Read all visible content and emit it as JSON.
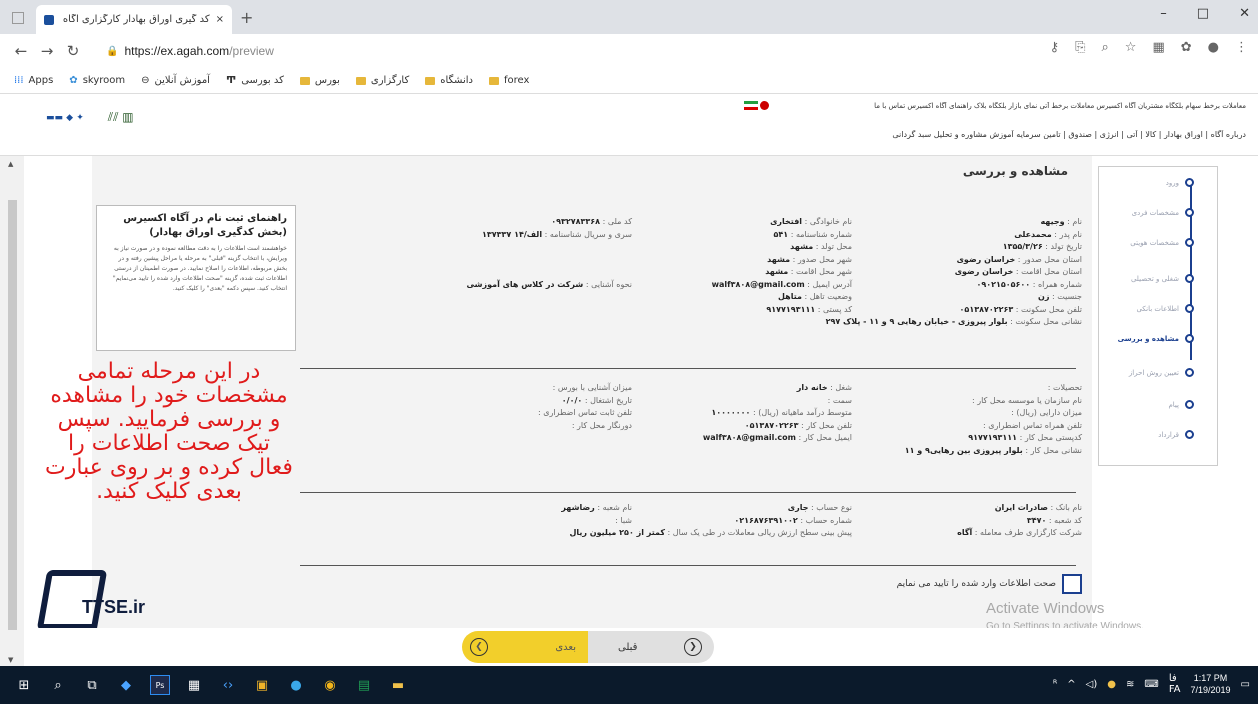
{
  "browser": {
    "tab_title": "کد گیری اوراق بهادار کارگزاری آگاه",
    "tab_close": "×",
    "new_tab": "+",
    "url_host": "https://ex.agah.com",
    "url_path": "/preview",
    "win_min": "–",
    "win_max": "□",
    "win_close": "✕",
    "bookmarks": [
      {
        "label": "Apps",
        "icon": "apps-grid-icon"
      },
      {
        "label": "skyroom",
        "icon": "skyroom-icon"
      },
      {
        "label": "آموزش آنلاین",
        "icon": "online-icon"
      },
      {
        "label": "کد بورسی",
        "icon": "tse-icon"
      },
      {
        "label": "بورس",
        "icon": "folder-icon"
      },
      {
        "label": "کارگزاری",
        "icon": "folder-icon"
      },
      {
        "label": "دانشگاه",
        "icon": "folder-icon"
      },
      {
        "label": "forex",
        "icon": "folder-icon"
      }
    ]
  },
  "site": {
    "top_menu": "معاملات برخط سهام   بلکگاه مشتریان   آگاه اکسیرس   معاملات برخط آتی   نمای بازار   بلکگاه بلاک   راهنمای آگاه اکسیرس   تماس با ما",
    "main_menu": "درباره آگاه  |  اوراق بهادار  |  کالا  |  آتی  |  انرژی  |  صندوق  |  تامین سرمایه   آموزش   مشاوره و تحلیل   سبد گردانی"
  },
  "steps": [
    {
      "label": "ورود",
      "active": false
    },
    {
      "label": "مشخصات فردی",
      "active": false
    },
    {
      "label": "مشخصات هویتی",
      "active": false
    },
    {
      "label": "شغلی و تحصیلی",
      "active": false
    },
    {
      "label": "اطلاعات بانکی",
      "active": false
    },
    {
      "label": "مشاهده و بررسی",
      "active": true
    },
    {
      "label": "تعیین روش احراز",
      "active": false
    },
    {
      "label": "پیام",
      "active": false
    },
    {
      "label": "قرارداد",
      "active": false
    }
  ],
  "page": {
    "title": "مشاهده و بررسی",
    "confirm_label": "صحت اطلاعات وارد شده را تایید می نمایم",
    "next_label": "بعدی",
    "prev_label": "قبلی"
  },
  "personal": {
    "col1": [
      {
        "l": "نام : ",
        "v": "وجیهه"
      },
      {
        "l": "نام پدر : ",
        "v": "محمدعلی"
      },
      {
        "l": "تاریخ تولد : ",
        "v": "۱۳۵۵/۳/۲۶"
      },
      {
        "l": "استان محل صدور : ",
        "v": "خراسان رضوی"
      },
      {
        "l": "استان محل اقامت : ",
        "v": "خراسان رضوی"
      },
      {
        "l": "شماره همراه : ",
        "v": "۰۹۰۲۱۵۰۵۶۰۰"
      },
      {
        "l": "جنسیت : ",
        "v": "زن"
      },
      {
        "l": "تلفن محل سکونت : ",
        "v": "۰۵۱۳۸۷۰۲۲۶۳"
      },
      {
        "l": "نشانی محل سکونت : ",
        "v": "بلوار پیروزی - خیابان رهایی ۹ و ۱۱ - پلاک ۲۹۷"
      }
    ],
    "col2": [
      {
        "l": "نام خانوادگی : ",
        "v": "افتخاری"
      },
      {
        "l": "شماره شناسنامه : ",
        "v": "۵۴۱"
      },
      {
        "l": "محل تولد : ",
        "v": "مشهد"
      },
      {
        "l": "شهر محل صدور : ",
        "v": "مشهد"
      },
      {
        "l": "شهر محل اقامت : ",
        "v": "مشهد"
      },
      {
        "l": "آدرس ایمیل : ",
        "v": "walf۳۸۰۸@gmail.com"
      },
      {
        "l": "وضعیت تاهل : ",
        "v": "متاهل"
      },
      {
        "l": "کد پستی : ",
        "v": "۹۱۷۷۱۹۳۱۱۱"
      }
    ],
    "col3": [
      {
        "l": "کد ملی : ",
        "v": "۰۹۳۲۷۸۳۳۶۸"
      },
      {
        "l": "سری و سریال شناسنامه : ",
        "v": "الف/۱۴ ۱۳۷۳۳۷"
      },
      {
        "l": "",
        "v": ""
      },
      {
        "l": "",
        "v": ""
      },
      {
        "l": "",
        "v": ""
      },
      {
        "l": "نحوه آشنایی : ",
        "v": "شرکت در کلاس های آموزشی"
      }
    ]
  },
  "job": {
    "col1": [
      {
        "l": "تحصیلات : ",
        "v": ""
      },
      {
        "l": "نام سازمان یا موسسه محل کار : ",
        "v": ""
      },
      {
        "l": "میزان دارایی (ریال) : ",
        "v": ""
      },
      {
        "l": "تلفن همراه تماس اضطراری : ",
        "v": ""
      },
      {
        "l": "کدپستی محل کار : ",
        "v": "۹۱۷۷۱۹۳۱۱۱"
      },
      {
        "l": "نشانی محل کار : ",
        "v": "بلوار پیروزی بین رهایی۹ و ۱۱"
      }
    ],
    "col2": [
      {
        "l": "شغل : ",
        "v": "خانه دار"
      },
      {
        "l": "سمت : ",
        "v": ""
      },
      {
        "l": "متوسط درآمد ماهیانه (ریال) : ",
        "v": "۱۰۰۰۰۰۰۰"
      },
      {
        "l": "تلفن محل کار : ",
        "v": "۰۵۱۳۸۷۰۲۲۶۳"
      },
      {
        "l": "ایمیل محل کار : ",
        "v": "walf۳۸۰۸@gmail.com"
      }
    ],
    "col3": [
      {
        "l": "میزان آشنایی با بورس : ",
        "v": ""
      },
      {
        "l": "تاریخ اشتغال : ",
        "v": "۰/۰/۰"
      },
      {
        "l": "تلفن ثابت تماس اضطراری : ",
        "v": ""
      },
      {
        "l": "دورنگار محل کار : ",
        "v": ""
      }
    ]
  },
  "bank": {
    "col1": [
      {
        "l": "نام بانک : ",
        "v": "صادرات ایران"
      },
      {
        "l": "کد شعبه : ",
        "v": "۳۴۷۰"
      },
      {
        "l": "شرکت کارگزاری طرف معامله : ",
        "v": "آگاه"
      }
    ],
    "col2": [
      {
        "l": "نوع حساب : ",
        "v": "جاری"
      },
      {
        "l": "شماره حساب : ",
        "v": "۰۲۱۶۸۷۶۳۹۱۰۰۲"
      },
      {
        "l": "پیش بینی سطح ارزش ریالی معاملات در طی یک سال : ",
        "v": "کمتر از ۲۵۰ میلیون ریال"
      }
    ],
    "col3": [
      {
        "l": "نام شعبه : ",
        "v": "رضاشهر"
      },
      {
        "l": "شبا : ",
        "v": ""
      }
    ]
  },
  "guide": {
    "heading": "راهنمای ثبت نام در آگاه اکسیرس (بخش کدگیری اوراق بهادار)",
    "body": "خواهشمند است اطلاعات را به دقت مطالعه نموده و در صورت نیاز به ویرایش، با انتخاب گزینه \"قبلی\" به مرحله یا مراحل پیشین رفته و در بخش مربوطه، اطلاعات را اصلاح نمایید. در صورت اطمینان از درستی اطلاعات ثبت شده، گزینه \"صحت اطلاعات وارد شده را تایید می‌نمایم\" انتخاب کنید. سپس دکمه \"بعدی\" را کلیک کنید."
  },
  "overlay_text": "در این مرحله تمامی مشخصات خود را مشاهده و بررسی فرمایید. سپس تیک صحت اطلاعات را فعال کرده و بر روی عبارت بعدی کلیک کنید.",
  "watermark_logo": "TTSE.ir",
  "activation": {
    "line1": "Activate Windows",
    "line2": "Go to Settings to activate Windows."
  },
  "taskbar": {
    "time": "1:17 PM",
    "date": "7/19/2019",
    "lang": "FA",
    "lang2": "فا"
  }
}
